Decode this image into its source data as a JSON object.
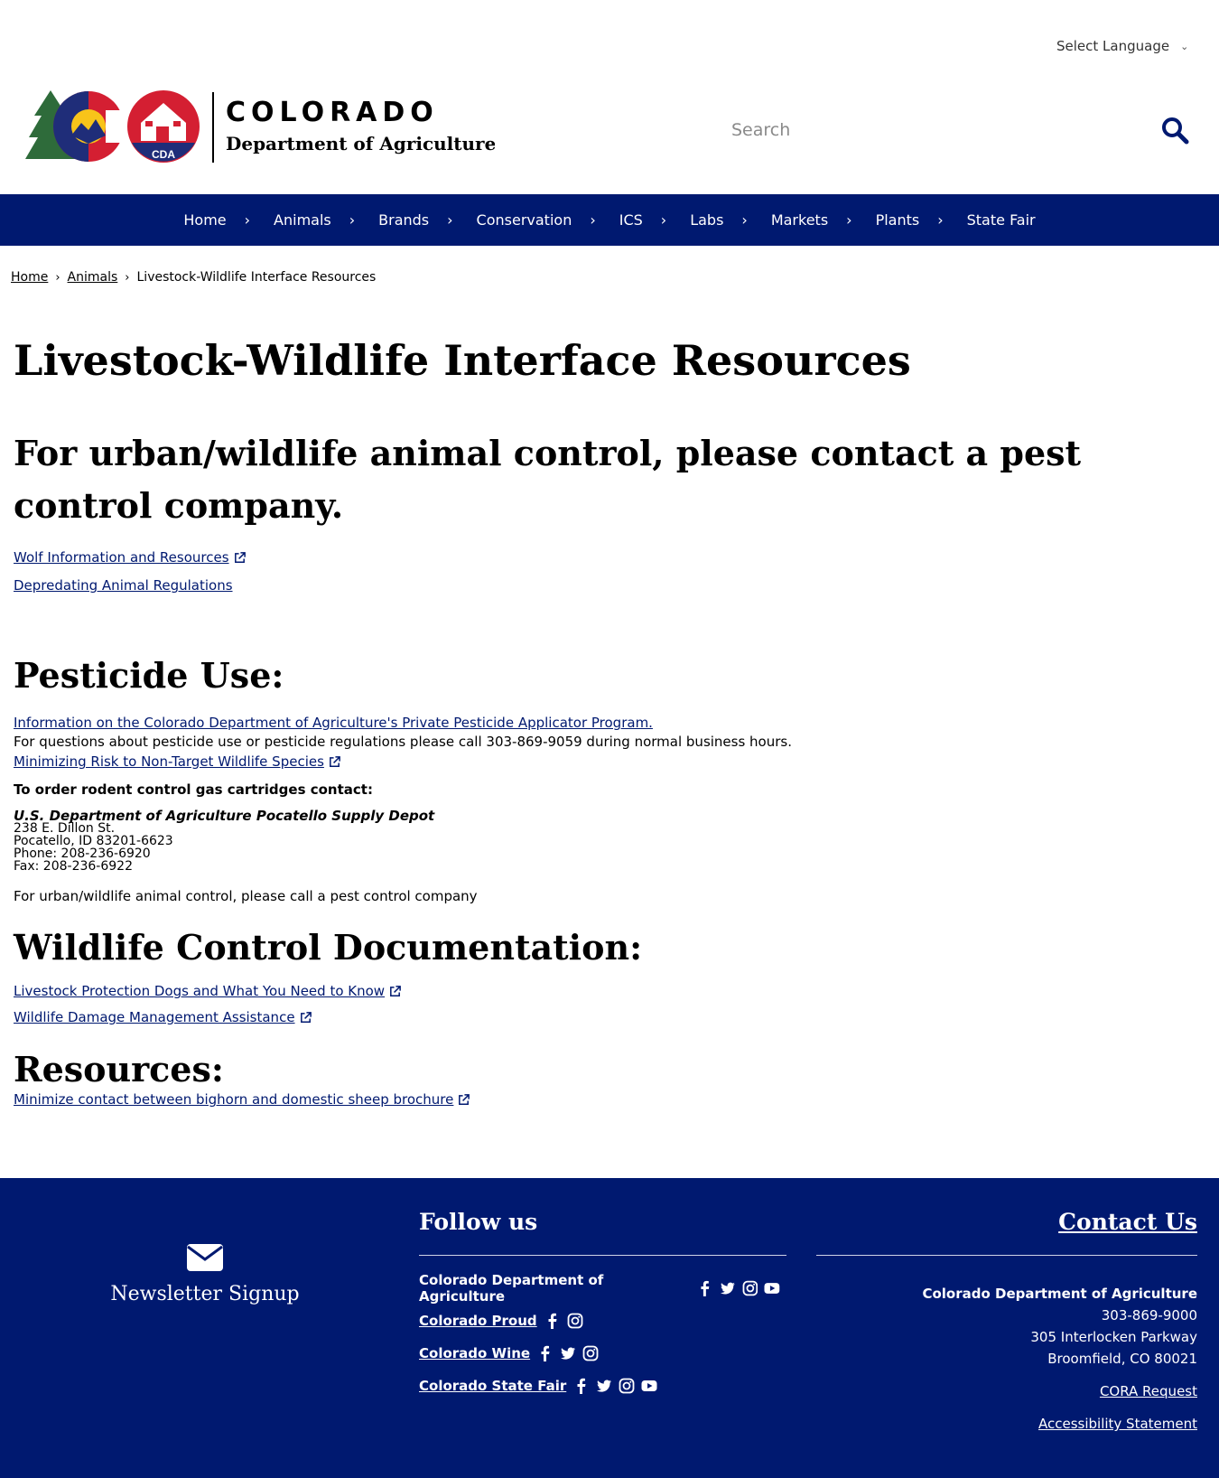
{
  "language": {
    "label": "Select Language"
  },
  "header": {
    "wordmark": "COLORADO",
    "department": "Department of Agriculture",
    "seal_text": "CDA",
    "search_placeholder": "Search"
  },
  "nav": [
    {
      "label": "Home"
    },
    {
      "label": "Animals"
    },
    {
      "label": "Brands"
    },
    {
      "label": "Conservation"
    },
    {
      "label": "ICS"
    },
    {
      "label": "Labs"
    },
    {
      "label": "Markets"
    },
    {
      "label": "Plants"
    },
    {
      "label": "State Fair"
    }
  ],
  "breadcrumb": {
    "home": "Home",
    "animals": "Animals",
    "current": "Livestock-Wildlife Interface Resources"
  },
  "page": {
    "title": "Livestock-Wildlife Interface Resources",
    "urban_heading": "For urban/wildlife animal control, please contact a pest control company.",
    "wolf_link": "Wolf Information and Resources",
    "depredating_link": "Depredating Animal Regulations",
    "pesticide_heading": "Pesticide Use:",
    "applicator_link": "Information on the Colorado Department of Agriculture's Private Pesticide Applicator Program.",
    "questions_text": "For questions about pesticide use or pesticide regulations please call 303-869-9059 during normal business hours.",
    "risk_link": "Minimizing Risk to Non-Target Wildlife Species",
    "order_label": "To order rodent control gas cartridges contact:",
    "depot_name": "U.S. Department of Agriculture Pocatello Supply Depot",
    "depot_street": "238 E. Dillon St.",
    "depot_city": "Pocatello, ID 83201-6623",
    "depot_phone": "Phone: 208-236-6920",
    "depot_fax": "Fax: 208-236-6922",
    "urban_note": "For urban/wildlife animal control, please call a pest control company",
    "wildlife_heading": "Wildlife Control Documentation:",
    "dogs_link": "Livestock Protection Dogs and What You Need to Know",
    "damage_link": "Wildlife Damage Management Assistance",
    "resources_heading": "Resources:",
    "bighorn_link": "Minimize contact between bighorn and domestic sheep brochure"
  },
  "footer": {
    "newsletter": "Newsletter Signup",
    "follow_heading": "Follow us",
    "social": {
      "cda": "Colorado Department of Agriculture",
      "proud": "Colorado Proud",
      "wine": "Colorado Wine",
      "fair": "Colorado State Fair"
    },
    "contact_heading": "Contact Us",
    "org": "Colorado Department of Agriculture",
    "phone": "303-869-9000",
    "street": "305 Interlocken Parkway",
    "city": "Broomfield, CO 80021",
    "cora": "CORA Request",
    "accessibility": "Accessibility Statement"
  },
  "colors": {
    "navy": "#001970",
    "co_red": "#d41f32",
    "co_gold": "#f8c41a",
    "tree_green": "#2e6b3a"
  },
  "icons": [
    "chevron-down-icon",
    "search-icon",
    "chevron-right-icon",
    "external-link-icon",
    "envelope-icon",
    "facebook-icon",
    "twitter-icon",
    "instagram-icon",
    "youtube-icon"
  ]
}
